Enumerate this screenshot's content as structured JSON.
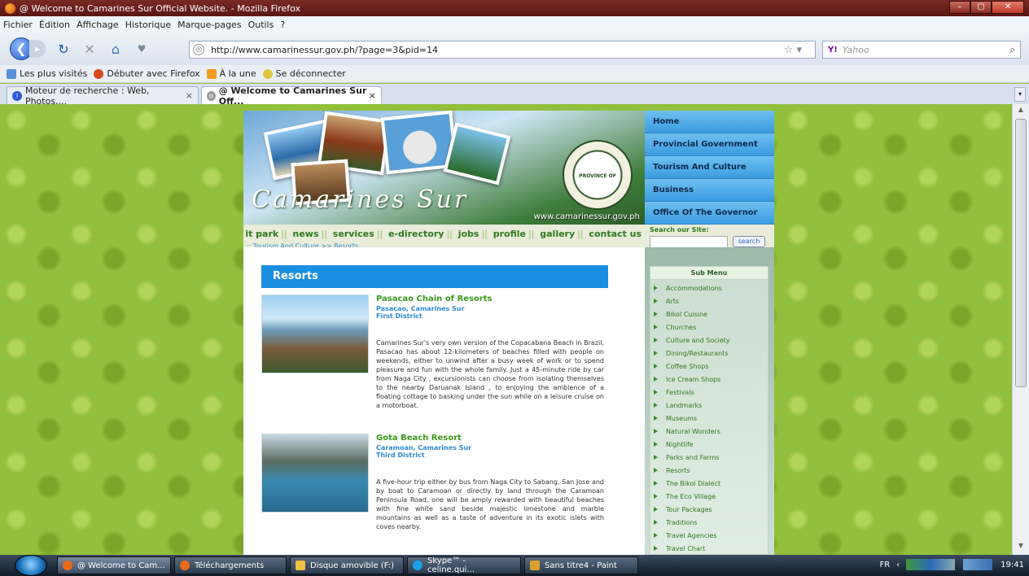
{
  "window": {
    "title": "@ Welcome to Camarines Sur Official Website. - Mozilla Firefox",
    "controls": [
      "–",
      "▢",
      "✕"
    ]
  },
  "menu": [
    "Fichier",
    "Édition",
    "Affichage",
    "Historique",
    "Marque-pages",
    "Outils",
    "?"
  ],
  "navbar": {
    "url": "http://www.camarinessur.gov.ph/?page=3&pid=14",
    "search_engine": "Y!",
    "search_placeholder": "Yahoo"
  },
  "bookmarks": [
    {
      "label": "Les plus visités"
    },
    {
      "label": "Débuter avec Firefox"
    },
    {
      "label": "À la une"
    },
    {
      "label": "Se déconnecter"
    }
  ],
  "tabs": [
    {
      "label": "Moteur de recherche : Web, Photos,..."
    },
    {
      "label": "@ Welcome to Camarines Sur Off..."
    }
  ],
  "site": {
    "banner_title": "Camarines Sur",
    "banner_url": "www.camarinessur.gov.ph",
    "seal_text": "PROVINCE OF CAMARINES SUR",
    "main_nav": [
      "Home",
      "Provincial Government",
      "Tourism And Culture",
      "Business",
      "Office Of The Governor"
    ],
    "top_links": [
      "it park",
      "news",
      "services",
      "e-directory",
      "jobs",
      "profile",
      "gallery",
      "contact us"
    ],
    "breadcrumb": ":: Tourism And Culture >> Resorts",
    "search": {
      "label": "Search our Site:",
      "button": "search"
    },
    "section_title": "Resorts",
    "resorts": [
      {
        "name": "Pasacao Chain of Resorts",
        "location": "Pasacao, Camarines Sur",
        "district": "First District",
        "description": "Camarines Sur's very own version of the Copacabana Beach in Brazil, Pasacao has about 12-kilometers of beaches filled with people on weekends, either to unwind after a busy week of work or to spend pleasure and fun with the whole family. Just a 45-minute ride by car from Naga City , excursionists can choose from isolating themselves to the nearby Daruanak Island , to enjoying the ambience of a floating cottage to basking under the sun while on a leisure cruise on a motorboat."
      },
      {
        "name": "Gota Beach Resort",
        "location": "Caramoan, Camarines Sur",
        "district": "Third District",
        "description": "A five-hour trip either by bus from Naga City to Sabang, San Jose and by boat to Caramoan or directly by land through the Caramoan Peninsula Road, one will be amply rewarded with beautiful beaches with fine white sand beside majestic limestone and marble mountains as well as a taste of adventure in its exotic islets with coves nearby."
      }
    ],
    "submenu": {
      "title": "Sub Menu",
      "items": [
        "Accommodations",
        "Arts",
        "Bikol Cuisine",
        "Churches",
        "Culture and Society",
        "Dining/Restaurants",
        "Coffee Shops",
        "Ice Cream Shops",
        "Festivals",
        "Landmarks",
        "Museums",
        "Natural Wonders",
        "Nightlife",
        "Parks and Farms",
        "Resorts",
        "The Bikol Dialect",
        "The Eco Village",
        "Tour Packages",
        "Traditions",
        "Travel Agencies",
        "Travel Chart"
      ]
    }
  },
  "taskbar": {
    "items": [
      "@ Welcome to Cam...",
      "Téléchargements",
      "Disque amovible (F:)",
      "Skype™ - celine.qui...",
      "Sans titre4 - Paint"
    ],
    "lang": "FR",
    "time": "19:41"
  }
}
